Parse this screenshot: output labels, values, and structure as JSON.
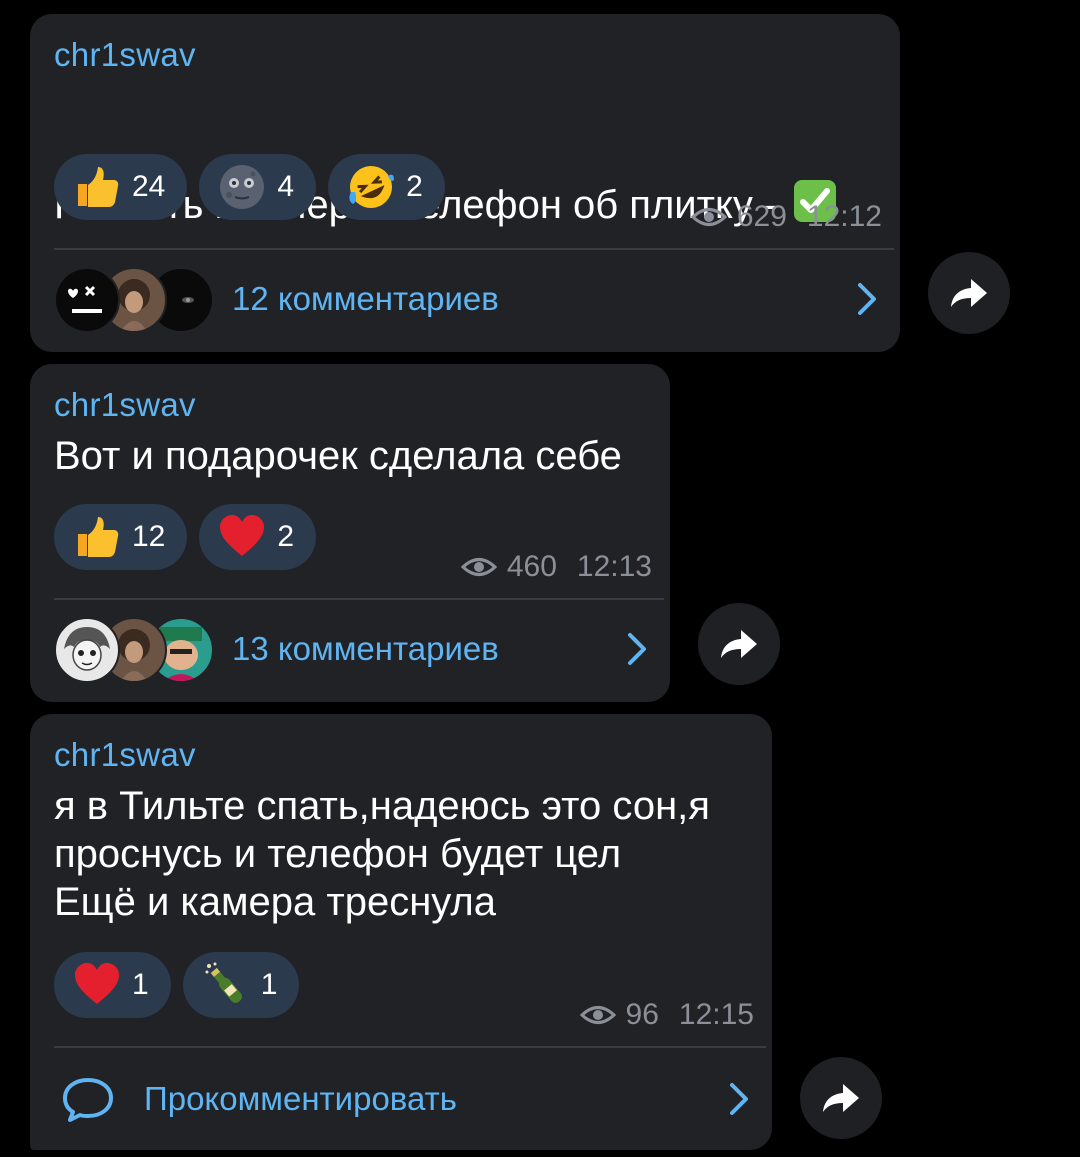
{
  "posts": [
    {
      "author": "chr1swav",
      "text": "Разбить насмерть телефон об плитку - ",
      "reactions": [
        {
          "icon": "thumbs-up-emoji",
          "count": "24"
        },
        {
          "icon": "new-moon-face-emoji",
          "count": "4"
        },
        {
          "icon": "rofl-emoji",
          "count": "2"
        }
      ],
      "views": "629",
      "time": "12:12",
      "comments_label": "12 комментариев"
    },
    {
      "author": "chr1swav",
      "text": "Вот и подарочек сделала себе",
      "reactions": [
        {
          "icon": "thumbs-up-emoji",
          "count": "12"
        },
        {
          "icon": "red-heart-emoji",
          "count": "2"
        }
      ],
      "views": "460",
      "time": "12:13",
      "comments_label": "13 комментариев"
    },
    {
      "author": "chr1swav",
      "text": "я в Тильте спать,надеюсь это сон,я\nпроснусь и телефон будет цел\nЕщё и камера треснула",
      "reactions": [
        {
          "icon": "red-heart-emoji",
          "count": "1"
        },
        {
          "icon": "champagne-emoji",
          "count": "1"
        }
      ],
      "views": "96",
      "time": "12:15",
      "comments_label": "Прокомментировать"
    }
  ],
  "colors": {
    "background": "#000000",
    "bubble": "#212226",
    "accent": "#5fb4f2",
    "reaction_pill": "#2b3a4c",
    "meta_text": "#8b9098"
  }
}
